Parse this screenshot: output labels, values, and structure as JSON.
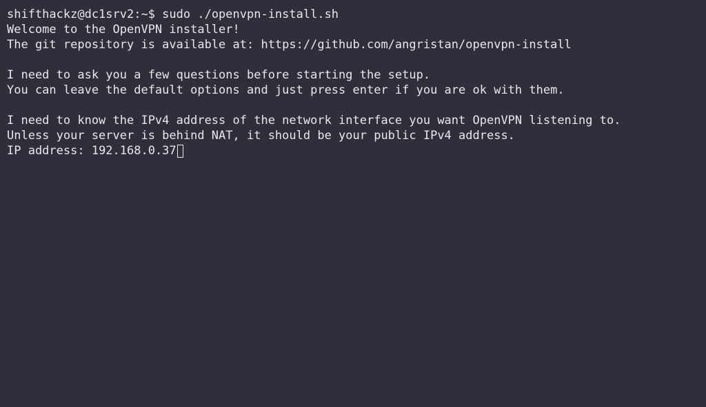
{
  "terminal": {
    "prompt": "shifthackz@dc1srv2:~$ ",
    "command": "sudo ./openvpn-install.sh",
    "lines": [
      "Welcome to the OpenVPN installer!",
      "The git repository is available at: https://github.com/angristan/openvpn-install",
      "",
      "I need to ask you a few questions before starting the setup.",
      "You can leave the default options and just press enter if you are ok with them.",
      "",
      "I need to know the IPv4 address of the network interface you want OpenVPN listening to.",
      "Unless your server is behind NAT, it should be your public IPv4 address."
    ],
    "input_label": "IP address: ",
    "input_value": "192.168.0.37"
  },
  "colors": {
    "background": "#2e2f3a",
    "foreground": "#e8e8ec"
  }
}
